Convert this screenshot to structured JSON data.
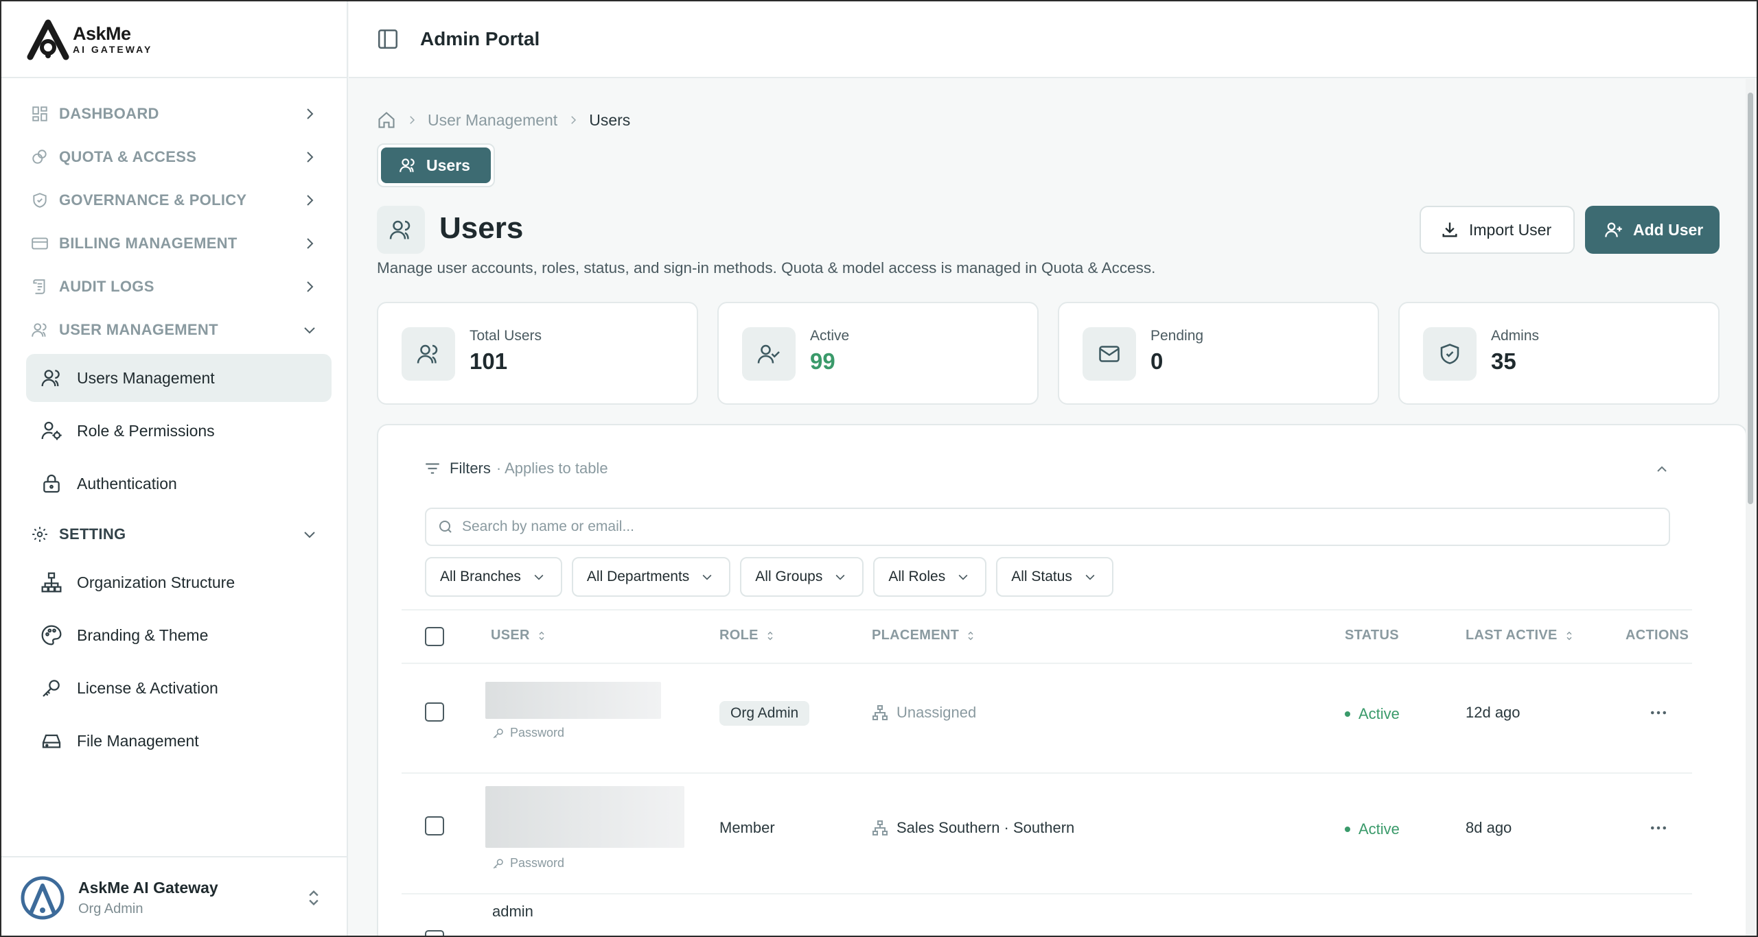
{
  "brand": {
    "line1": "AskMe",
    "line2": "AI GATEWAY"
  },
  "header": {
    "title": "Admin Portal"
  },
  "sidebar": {
    "sections": [
      {
        "label": "DASHBOARD",
        "icon": "dashboard-icon"
      },
      {
        "label": "QUOTA & ACCESS",
        "icon": "quota-icon"
      },
      {
        "label": "GOVERNANCE & POLICY",
        "icon": "shield-icon"
      },
      {
        "label": "BILLING MANAGEMENT",
        "icon": "credit-card-icon"
      },
      {
        "label": "AUDIT LOGS",
        "icon": "scroll-icon"
      },
      {
        "label": "USER MANAGEMENT",
        "icon": "users-icon"
      },
      {
        "label": "SETTING",
        "icon": "gear-icon"
      }
    ],
    "user_management_items": [
      {
        "label": "Users Management",
        "icon": "users-icon"
      },
      {
        "label": "Role & Permissions",
        "icon": "user-gear-icon"
      },
      {
        "label": "Authentication",
        "icon": "lock-icon"
      }
    ],
    "setting_items": [
      {
        "label": "Organization Structure",
        "icon": "org-chart-icon"
      },
      {
        "label": "Branding & Theme",
        "icon": "palette-icon"
      },
      {
        "label": "License & Activation",
        "icon": "key-icon"
      },
      {
        "label": "File Management",
        "icon": "drive-icon"
      }
    ],
    "footer": {
      "name": "AskMe AI Gateway",
      "role": "Org Admin"
    }
  },
  "breadcrumb": {
    "items": [
      "User Management",
      "Users"
    ]
  },
  "tab": {
    "label": "Users"
  },
  "page": {
    "title": "Users",
    "description": "Manage user accounts, roles, status, and sign-in methods. Quota & model access is managed in Quota & Access.",
    "import_label": "Import User",
    "add_label": "Add User"
  },
  "stats": [
    {
      "label": "Total Users",
      "value": "101"
    },
    {
      "label": "Active",
      "value": "99"
    },
    {
      "label": "Pending",
      "value": "0"
    },
    {
      "label": "Admins",
      "value": "35"
    }
  ],
  "filters": {
    "title": "Filters",
    "subtitle": "· Applies to table",
    "search_placeholder": "Search by name or email...",
    "dropdowns": [
      "All Branches",
      "All Departments",
      "All Groups",
      "All Roles",
      "All Status"
    ]
  },
  "table": {
    "columns": [
      "USER",
      "ROLE",
      "PLACEMENT",
      "STATUS",
      "LAST ACTIVE",
      "ACTIONS"
    ],
    "rows": [
      {
        "auth": "Password",
        "role": "Org Admin",
        "placement": "Unassigned",
        "status": "Active",
        "last_active": "12d ago"
      },
      {
        "auth": "Password",
        "role": "Member",
        "placement": "Sales Southern · Southern",
        "status": "Active",
        "last_active": "8d ago"
      },
      {
        "name": "admin"
      }
    ]
  },
  "colors": {
    "accent": "#3d6b72",
    "active_green": "#3a9a6a"
  }
}
